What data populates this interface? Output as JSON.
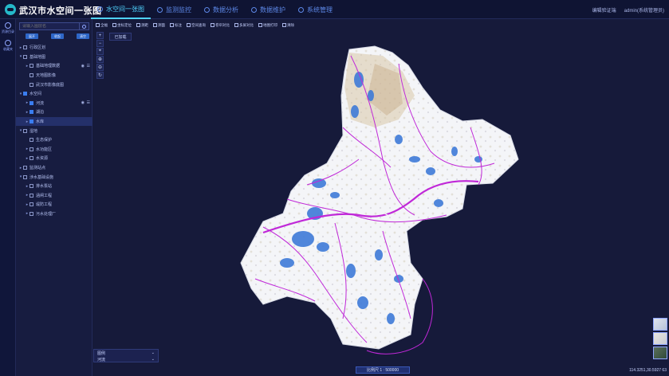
{
  "header": {
    "app_title": "武汉市水空间一张图",
    "nav": [
      "水空间一张图",
      "监测监控",
      "数据分析",
      "数据维护",
      "系统管理"
    ],
    "active_nav": 0,
    "right_links": [
      "编辑验证端",
      "admin(系统管理员)"
    ]
  },
  "left_nav": [
    {
      "label": "资源目录",
      "icon": "layers-icon"
    },
    {
      "label": "收藏夹",
      "icon": "power-icon"
    }
  ],
  "layer_panel": {
    "search_placeholder": "请输入图层名",
    "buttons": [
      "展开",
      "收起",
      "清空"
    ],
    "tree": [
      {
        "label": "行政区划",
        "level": 0,
        "caret": "▸",
        "checked": false
      },
      {
        "label": "基础地图",
        "level": 0,
        "caret": "▾",
        "checked": false
      },
      {
        "label": "基础地理数据",
        "level": 1,
        "caret": "▸",
        "checked": false,
        "tools": true
      },
      {
        "label": "天地图影像",
        "level": 1,
        "caret": "",
        "checked": false
      },
      {
        "label": "武汉市影像底图",
        "level": 1,
        "caret": "",
        "checked": false
      },
      {
        "label": "水空间",
        "level": 0,
        "caret": "▾",
        "checked": true
      },
      {
        "label": "河流",
        "level": 1,
        "caret": "▸",
        "checked": true,
        "tools": true
      },
      {
        "label": "湖泊",
        "level": 1,
        "caret": "▸",
        "checked": true
      },
      {
        "label": "水库",
        "level": 1,
        "caret": "▸",
        "checked": true,
        "selected": true
      },
      {
        "label": "湿地",
        "level": 0,
        "caret": "▾",
        "checked": false
      },
      {
        "label": "生态保护",
        "level": 1,
        "caret": "",
        "checked": false
      },
      {
        "label": "水功能区",
        "level": 1,
        "caret": "▸",
        "checked": false
      },
      {
        "label": "水资源",
        "level": 1,
        "caret": "▸",
        "checked": false
      },
      {
        "label": "监测站点",
        "level": 0,
        "caret": "▸",
        "checked": false
      },
      {
        "label": "涉水基础设施",
        "level": 0,
        "caret": "▾",
        "checked": false
      },
      {
        "label": "排水泵站",
        "level": 1,
        "caret": "▸",
        "checked": false
      },
      {
        "label": "涵闸工程",
        "level": 1,
        "caret": "▸",
        "checked": false
      },
      {
        "label": "堤防工程",
        "level": 1,
        "caret": "▸",
        "checked": false
      },
      {
        "label": "污水处理厂",
        "level": 1,
        "caret": "▸",
        "checked": false
      }
    ]
  },
  "toolbar": [
    {
      "label": "全幅",
      "icon": "globe-icon"
    },
    {
      "label": "坐标定位",
      "icon": "crosshair-icon"
    },
    {
      "label": "测距",
      "icon": "ruler-icon"
    },
    {
      "label": "测面",
      "icon": "area-icon"
    },
    {
      "label": "标注",
      "icon": "pin-icon"
    },
    {
      "label": "空间查询",
      "icon": "query-icon"
    },
    {
      "label": "卷帘对比",
      "icon": "swipe-icon"
    },
    {
      "label": "多屏对比",
      "icon": "split-icon"
    },
    {
      "label": "地图打印",
      "icon": "print-icon"
    },
    {
      "label": "清除",
      "icon": "eraser-icon"
    }
  ],
  "map_controls": [
    "+",
    "−",
    "⌖",
    "⊕",
    "⊖",
    "↻"
  ],
  "layer_tab": "已加载",
  "bottom_select": {
    "top": "图例",
    "bottom": "河流"
  },
  "scale": "比例尺 1 : 500000",
  "coords": "114.3251,30.5927 63",
  "colors": {
    "water": "#3f7bd8",
    "river": "#c028d8",
    "land": "#f2f3f7",
    "background": "#161a3a"
  }
}
